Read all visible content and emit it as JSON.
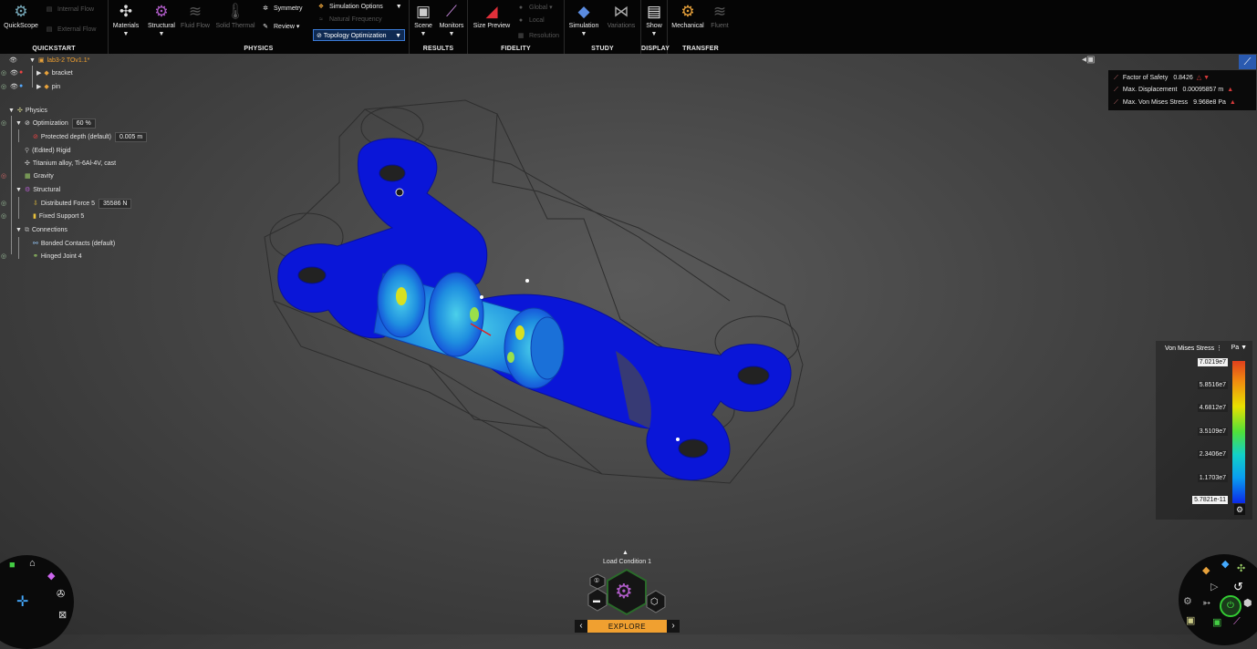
{
  "ribbon": {
    "quickstart": {
      "title": "QUICKSTART",
      "quickscope": "QuickScope",
      "internal_flow": "Internal Flow",
      "external_flow": "External Flow"
    },
    "physics": {
      "title": "PHYSICS",
      "materials": "Materials",
      "structural": "Structural",
      "fluid_flow": "Fluid Flow",
      "solid_thermal": "Solid Thermal",
      "symmetry": "Symmetry",
      "review": "Review",
      "simulation_options": "Simulation Options",
      "natural_frequency": "Natural Frequency",
      "topology_optimization": "Topology Optimization"
    },
    "results": {
      "title": "RESULTS",
      "scene": "Scene",
      "monitors": "Monitors"
    },
    "fidelity": {
      "title": "FIDELITY",
      "size_preview": "Size Preview",
      "global": "Global",
      "local": "Local",
      "resolution": "Resolution"
    },
    "study": {
      "title": "STUDY",
      "simulation": "Simulation",
      "variations": "Variations"
    },
    "display": {
      "title": "DISPLAY",
      "show": "Show"
    },
    "transfer": {
      "title": "TRANSFER",
      "mechanical": "Mechanical",
      "fluent": "Fluent"
    }
  },
  "tree": {
    "project": "lab3-2 TOv1.1*",
    "bracket": "bracket",
    "pin": "pin",
    "physics": "Physics",
    "optimization": "Optimization",
    "optimization_value": "60 %",
    "protected_depth": "Protected depth (default)",
    "protected_depth_value": "0.005 m",
    "edited_rigid": "(Edited) Rigid",
    "material": "Titanium alloy, Ti-6Al-4V, cast",
    "gravity": "Gravity",
    "structural": "Structural",
    "distributed_force": "Distributed Force 5",
    "distributed_force_value": "35586 N",
    "fixed_support": "Fixed Support 5",
    "connections": "Connections",
    "bonded_contacts": "Bonded Contacts (default)",
    "hinged_joint": "Hinged Joint 4"
  },
  "results": {
    "factor_of_safety_label": "Factor of Safety",
    "factor_of_safety_value": "0.8426",
    "max_displacement_label": "Max. Displacement",
    "max_displacement_value": "0.00095857 m",
    "max_von_mises_label": "Max. Von Mises Stress",
    "max_von_mises_value": "9.968e8 Pa"
  },
  "legend": {
    "title": "Von Mises Stress",
    "unit": "Pa",
    "ticks": [
      "7.0219e7",
      "5.8516e7",
      "4.6812e7",
      "3.5109e7",
      "2.3406e7",
      "1.1703e7",
      "5.7821e-11"
    ]
  },
  "bottom": {
    "load_condition": "Load Condition 1",
    "explore": "EXPLORE"
  },
  "colors": {
    "accent": "#3b7bd6",
    "explore": "#f0a030",
    "part": "#0a16d8"
  }
}
